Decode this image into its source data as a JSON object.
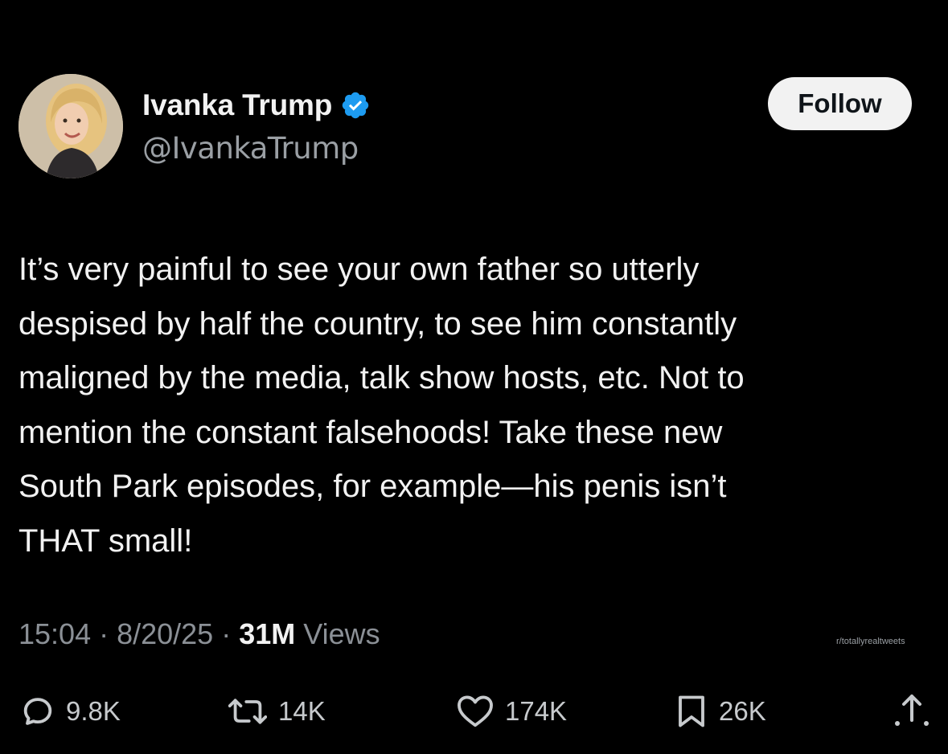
{
  "author": {
    "display_name": "Ivanka Trump",
    "handle": "@IvankaTrump",
    "verified": true
  },
  "follow_button": {
    "label": "Follow"
  },
  "tweet": {
    "text": "It’s very painful to see your own father so utterly\ndespised by half the country, to see him constantly\nmaligned by the media, talk show hosts, etc. Not to\nmention the constant falsehoods! Take these new\nSouth Park episodes, for example—his penis isn’t\nTHAT small!",
    "time": "15:04",
    "date": "8/20/25",
    "views_count": "31M",
    "views_label": "Views"
  },
  "watermark": "r/totallyrealtweets",
  "actions": {
    "replies": "9.8K",
    "reposts": "14K",
    "likes": "174K",
    "bookmarks": "26K"
  },
  "icons": {
    "reply": "reply-icon",
    "repost": "repost-icon",
    "like": "heart-icon",
    "bookmark": "bookmark-icon",
    "share": "share-icon",
    "verified": "verified-badge-icon"
  },
  "colors": {
    "background": "#000000",
    "text_primary": "#f2f2f2",
    "text_secondary": "#8b9096",
    "verified_blue": "#1d9bf0",
    "follow_bg": "#f2f2f2"
  }
}
